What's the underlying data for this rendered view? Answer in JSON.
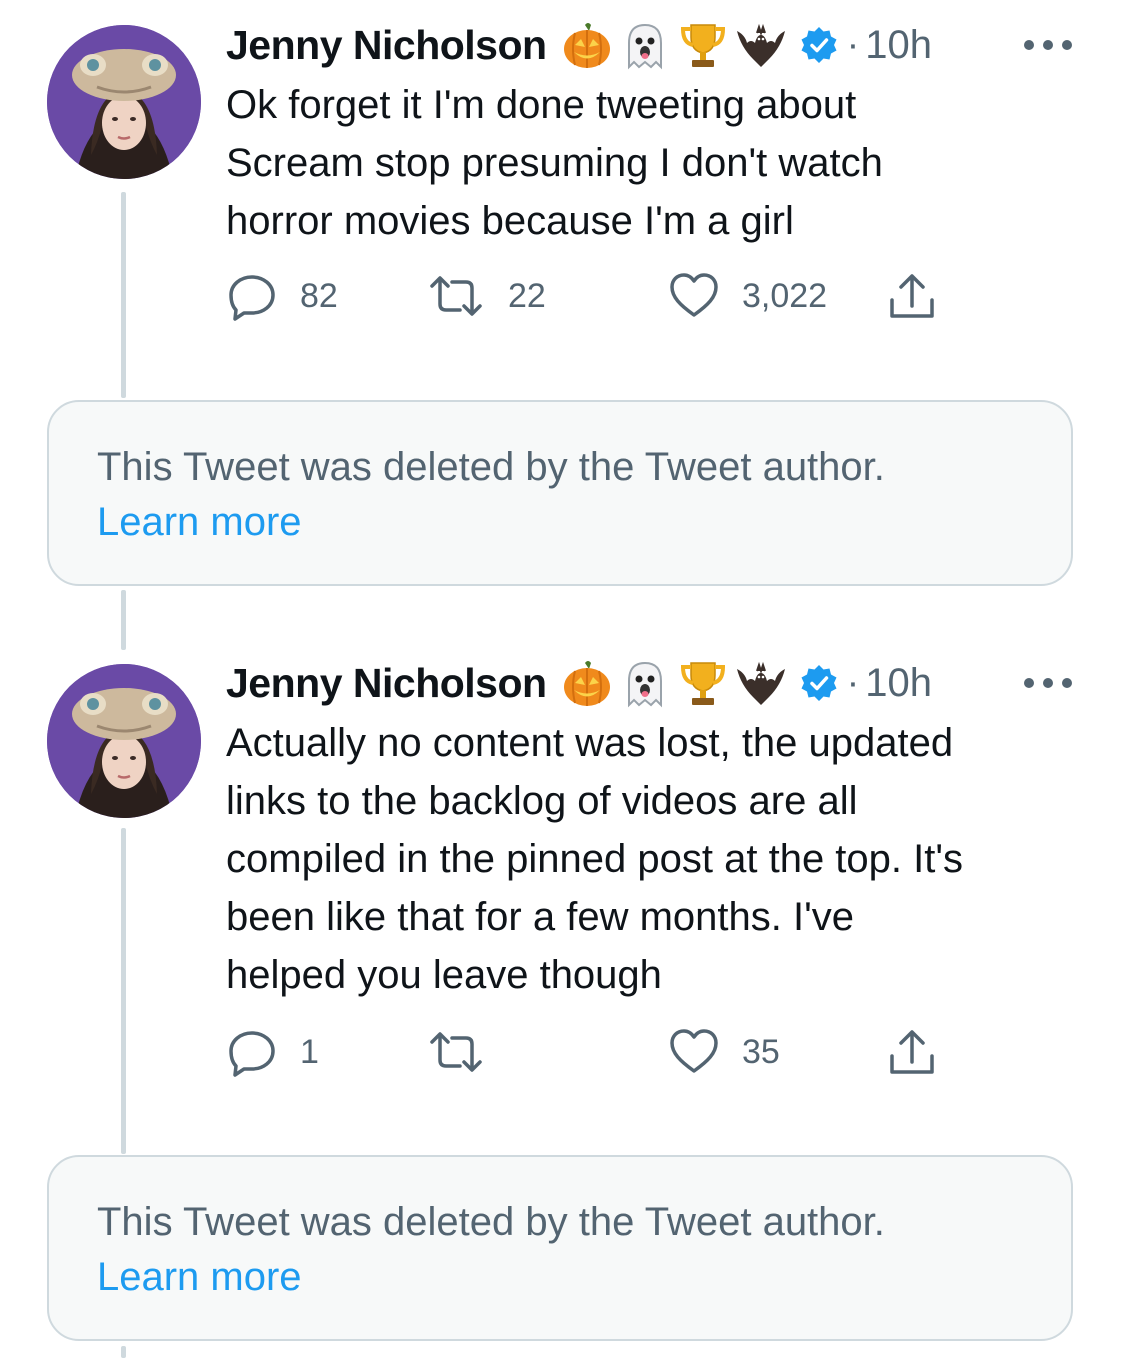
{
  "tweets": [
    {
      "author": "Jenny Nicholson",
      "emoji_icons": [
        "jack-o-lantern-icon",
        "ghost-icon",
        "trophy-icon",
        "bat-icon"
      ],
      "verified": true,
      "separator": "·",
      "time": "10h",
      "text_lines": [
        "Ok forget it I'm done tweeting about",
        "Scream stop presuming I don't watch",
        "horror movies because I'm a girl"
      ],
      "replies": "82",
      "retweets": "22",
      "likes": "3,022"
    },
    {
      "author": "Jenny Nicholson",
      "emoji_icons": [
        "jack-o-lantern-icon",
        "ghost-icon",
        "trophy-icon",
        "bat-icon"
      ],
      "verified": true,
      "separator": "·",
      "time": "10h",
      "text_lines": [
        "Actually no content was lost, the updated",
        "links to the backlog of videos are all",
        "compiled in the pinned post at the top. It's",
        "been like that for a few months. I've",
        "helped you leave though"
      ],
      "replies": "1",
      "retweets": "",
      "likes": "35"
    }
  ],
  "deleted_notices": [
    {
      "message": "This Tweet was deleted by the Tweet author.",
      "link": "Learn more"
    },
    {
      "message": "This Tweet was deleted by the Tweet author.",
      "link": "Learn more"
    }
  ],
  "colors": {
    "text": "#0f1419",
    "secondary": "#536471",
    "link": "#1d9bf0",
    "verified": "#1d9bf0",
    "avatar_bg": "#6a4aa6",
    "thread_line": "#cfd9de"
  }
}
